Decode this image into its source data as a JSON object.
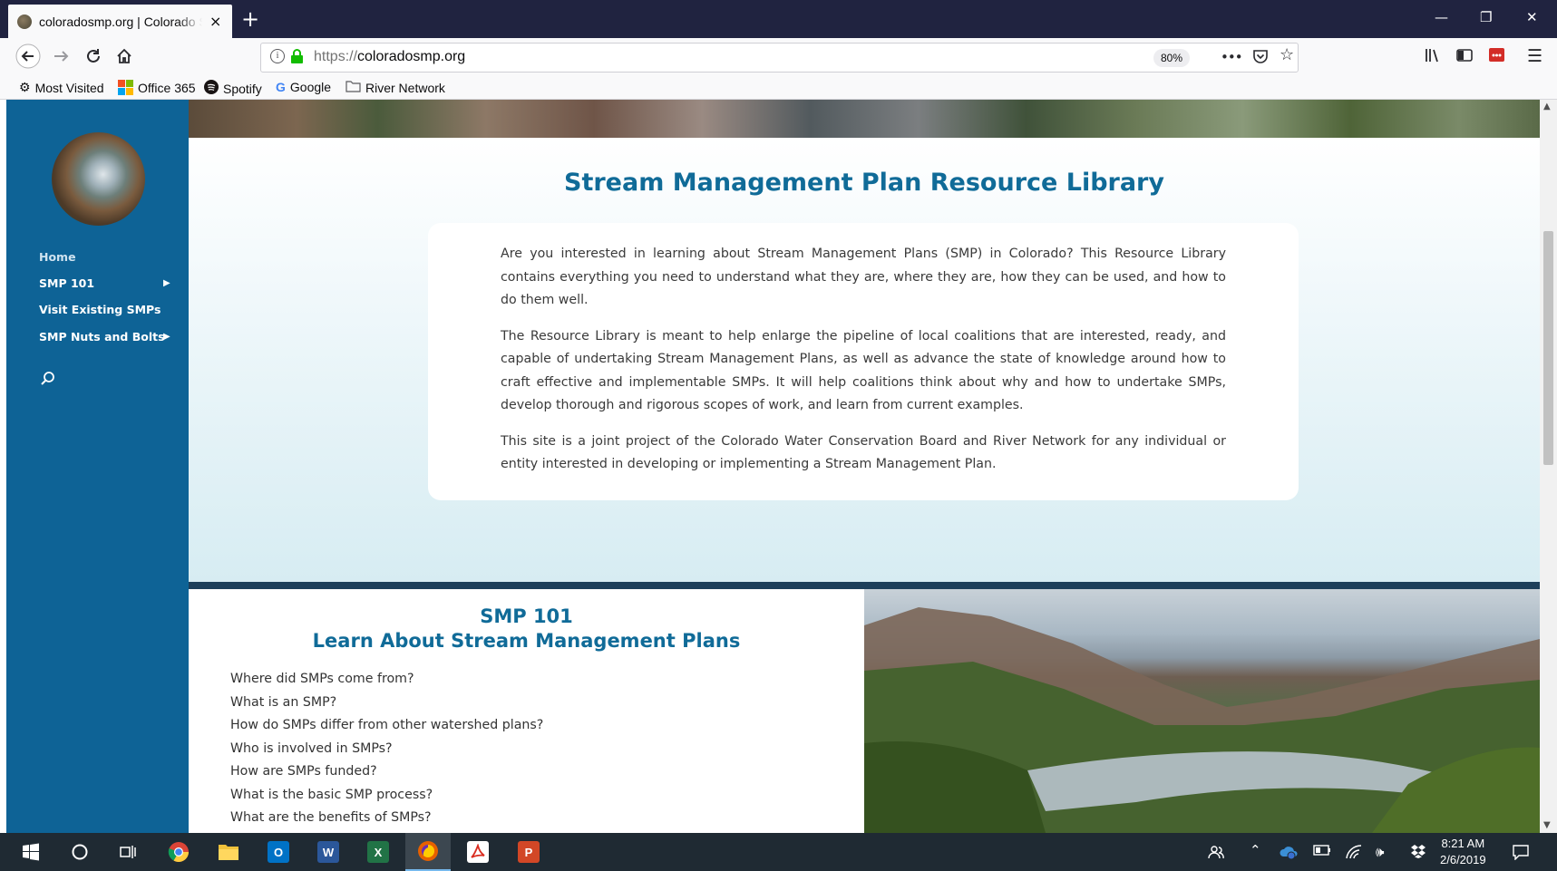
{
  "browser": {
    "tab_title": "coloradosmp.org | Colorado Stream Management Plans",
    "tab_close_icon": "×",
    "new_tab_icon": "+",
    "url_protocol": "https://",
    "url_domain": "coloradosmp.org",
    "zoom": "80%",
    "page_actions_icon": "•••",
    "bookmarks": [
      {
        "label": "Most Visited"
      },
      {
        "label": "Office 365"
      },
      {
        "label": "Spotify"
      },
      {
        "label": "Google"
      },
      {
        "label": "River Network"
      }
    ]
  },
  "sidebar": {
    "nav": [
      {
        "label": "Home"
      },
      {
        "label": "SMP 101"
      },
      {
        "label": "Visit Existing SMPs"
      },
      {
        "label": "SMP Nuts and Bolts"
      }
    ]
  },
  "intro": {
    "title": "Stream Management Plan Resource Library",
    "paragraphs": [
      "Are you interested in learning about Stream Management Plans (SMP) in Colorado? This Resource Library contains everything you need to understand what they are, where they are, how they can be used, and how to do them well.",
      "The Resource Library is meant to help enlarge the pipeline of local coalitions that are interested, ready, and capable of undertaking Stream Management Plans, as well as advance the state of knowledge around how to craft effective and implementable SMPs. It will help coalitions think about why and how to undertake SMPs, develop thorough and rigorous scopes of work, and learn from current examples.",
      "This site is a joint project of the Colorado Water Conservation Board and River Network for any individual or entity interested in developing or implementing a Stream Management Plan."
    ]
  },
  "smp101": {
    "title": "SMP 101",
    "subtitle": "Learn About Stream Management Plans",
    "links": [
      "Where did SMPs come from?",
      "What is an SMP?",
      "How do SMPs differ from other watershed plans?",
      "Who is involved in SMPs?",
      "How are SMPs funded?",
      "What is the basic SMP process?",
      "What are the benefits of SMPs?"
    ]
  },
  "taskbar": {
    "apps": [
      "start",
      "cortana",
      "task-view",
      "chrome",
      "file-explorer",
      "outlook",
      "word",
      "excel",
      "firefox",
      "acrobat",
      "powerpoint"
    ],
    "app_letters": {
      "outlook": "O",
      "word": "W",
      "excel": "X",
      "powerpoint": "P"
    },
    "time": "8:21 AM",
    "date": "2/6/2019"
  },
  "colors": {
    "sidebar": "#0e6396",
    "heading": "#106b98",
    "titlebar": "#202340",
    "taskbar": "#1f2a33"
  }
}
